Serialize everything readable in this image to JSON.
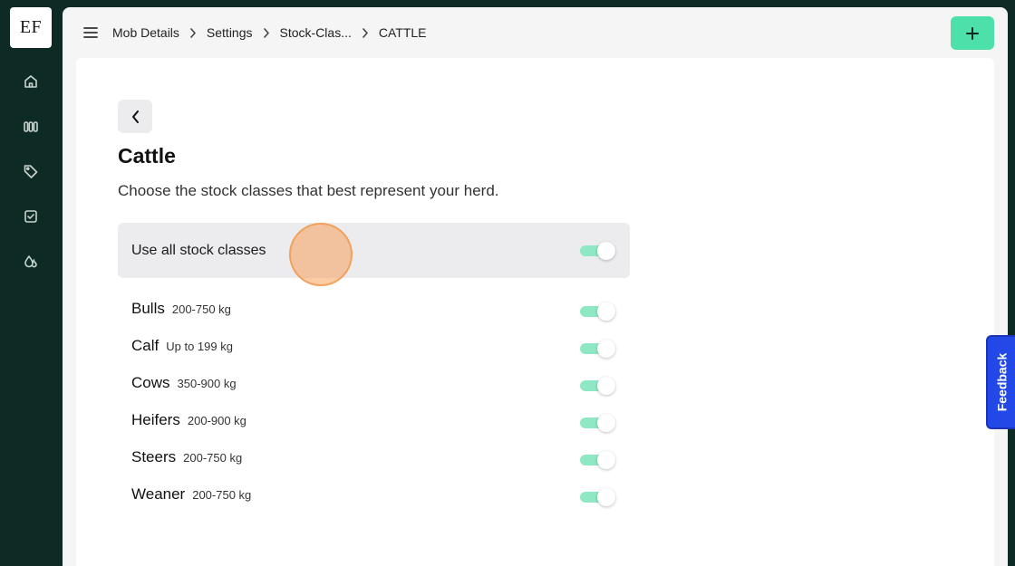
{
  "logo": {
    "text": "EF"
  },
  "rail": {
    "icons": [
      "home-icon",
      "columns-icon",
      "tag-icon",
      "checkbox-icon",
      "droplets-icon"
    ]
  },
  "breadcrumb": {
    "items": [
      "Mob Details",
      "Settings",
      "Stock-Clas...",
      "CATTLE"
    ]
  },
  "page": {
    "title": "Cattle",
    "subtitle": "Choose the stock classes that best represent your herd."
  },
  "all_classes": {
    "label": "Use all stock classes",
    "enabled": true
  },
  "stock_classes": [
    {
      "name": "Bulls",
      "range": "200-750 kg",
      "enabled": true
    },
    {
      "name": "Calf",
      "range": "Up to 199 kg",
      "enabled": true
    },
    {
      "name": "Cows",
      "range": "350-900 kg",
      "enabled": true
    },
    {
      "name": "Heifers",
      "range": "200-900 kg",
      "enabled": true
    },
    {
      "name": "Steers",
      "range": "200-750 kg",
      "enabled": true
    },
    {
      "name": "Weaner",
      "range": "200-750 kg",
      "enabled": true
    }
  ],
  "feedback": {
    "label": "Feedback"
  },
  "colors": {
    "rail": "#0d2b24",
    "accent": "#4ee0aa",
    "toggle_on": "#8fe8c4",
    "feedback": "#2348e8"
  }
}
